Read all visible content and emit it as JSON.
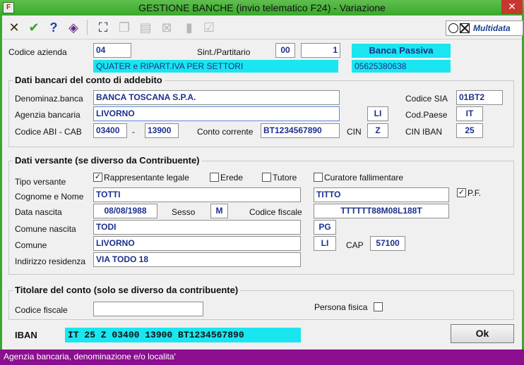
{
  "window": {
    "title": "GESTIONE BANCHE (invio telematico F24) - Variazione",
    "icon_text": "F",
    "close_glyph": "✕"
  },
  "toolbar": {
    "icons": [
      "cancel-icon",
      "confirm-icon",
      "help-icon",
      "tag-icon",
      "binoculars-icon",
      "copy-icon",
      "paste-icon",
      "no-icon",
      "doc-icon",
      "check-list-icon"
    ],
    "logo_text": "Multidata"
  },
  "header": {
    "codice_azienda_label": "Codice azienda",
    "codice_azienda_value": "04",
    "sint_label": "Sint./Partitario",
    "sint_value": "00",
    "partitario_value": "1",
    "banca_passiva": "Banca Passiva",
    "company_name": "QUATER e RIPART.IVA PER SETTORI",
    "company_piva": "05625380638"
  },
  "bank": {
    "group_title": "Dati bancari del conto di addebito",
    "denominaz_label": "Denominaz.banca",
    "denominaz_value": "BANCA TOSCANA S.P.A.",
    "agenzia_label": "Agenzia bancaria",
    "agenzia_value": "LIVORNO",
    "provincia_value": "LI",
    "abi_cab_label": "Codice ABI - CAB",
    "abi_value": "03400",
    "dash": "-",
    "cab_value": "13900",
    "conto_label": "Conto corrente",
    "conto_value": "BT1234567890",
    "cin_label": "CIN",
    "cin_value": "Z",
    "sia_label": "Codice SIA",
    "sia_value": "01BT2",
    "paese_label": "Cod.Paese",
    "paese_value": "IT",
    "cin_iban_label": "CIN IBAN",
    "cin_iban_value": "25"
  },
  "versante": {
    "group_title": "Dati versante (se diverso da Contribuente)",
    "tipo_label": "Tipo versante",
    "opt_rappresentante": "Rappresentante legale",
    "opt_erede": "Erede",
    "opt_tutore": "Tutore",
    "opt_curatore": "Curatore fallimentare",
    "cognome_label": "Cognome e Nome",
    "cognome_value": "TOTTI",
    "nome_value": "TITTO",
    "pf_label": "P.F.",
    "nascita_label": "Data nascita",
    "nascita_value": "08/08/1988",
    "sesso_label": "Sesso",
    "sesso_value": "M",
    "cf_label": "Codice fiscale",
    "cf_value": "TTTTTT88M08L188T",
    "comune_nascita_label": "Comune nascita",
    "comune_nascita_value": "TODI",
    "prov_nascita_value": "PG",
    "comune_label": "Comune",
    "comune_value": "LIVORNO",
    "prov_value": "LI",
    "cap_label": "CAP",
    "cap_value": "57100",
    "indirizzo_label": "Indirizzo residenza",
    "indirizzo_value": "VIA TODO 18",
    "check_mark": "✓"
  },
  "titolare": {
    "group_title": "Titolare del conto (solo se diverso da contribuente)",
    "cf_label": "Codice fiscale",
    "cf_value": "",
    "persona_label": "Persona fisica"
  },
  "footer": {
    "iban_label": "IBAN",
    "iban_value": "IT 25 Z 03400 13900 BT1234567890",
    "ok_label": "Ok",
    "status_text": "Agenzia bancaria, denominazione e/o localita'"
  },
  "colors": {
    "titlebar": "#39a82b",
    "highlight": "#19e6f0",
    "value_text": "#1c2f8e",
    "statusbar": "#8b0f8f"
  }
}
